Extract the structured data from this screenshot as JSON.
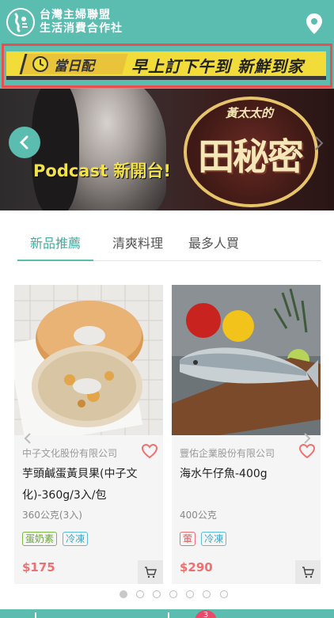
{
  "header": {
    "org_name_line1": "台灣主婦聯盟",
    "org_name_line2": "生活消費合作社",
    "logo_icon": "co-op-logo-icon",
    "location_icon": "map-pin-icon"
  },
  "delivery_banner": {
    "tag": "當日配",
    "slogan": "早上訂下午到 新鮮到家",
    "icon": "delivery-clock-icon",
    "colors": {
      "bar": "#f2dc3a",
      "frame": "#e85050"
    }
  },
  "promo_banner": {
    "headline": "Podcast 新開台!",
    "brand": "黃太太的",
    "title": "田秘密"
  },
  "tabs": [
    {
      "label": "新品推薦",
      "active": true
    },
    {
      "label": "清爽料理",
      "active": false
    },
    {
      "label": "最多人買",
      "active": false
    }
  ],
  "products": [
    {
      "vendor": "中子文化股份有限公司",
      "name": "芋頭鹹蛋黃貝果(中子文化)-360g/3入/包",
      "spec": "360公克(3入)",
      "tags": [
        "蛋奶素",
        "冷凍"
      ],
      "price": "$175"
    },
    {
      "vendor": "豐佑企業股份有限公司",
      "name": "海水午仔魚-400g",
      "spec": "400公克",
      "tags": [
        "葷",
        "冷凍"
      ],
      "price": "$290"
    }
  ],
  "pagination": {
    "total": 7,
    "current": 1
  },
  "cart": {
    "count": "3"
  },
  "colors": {
    "accent": "#5bbcb0",
    "price": "#f07070",
    "heart": "#f07070"
  }
}
